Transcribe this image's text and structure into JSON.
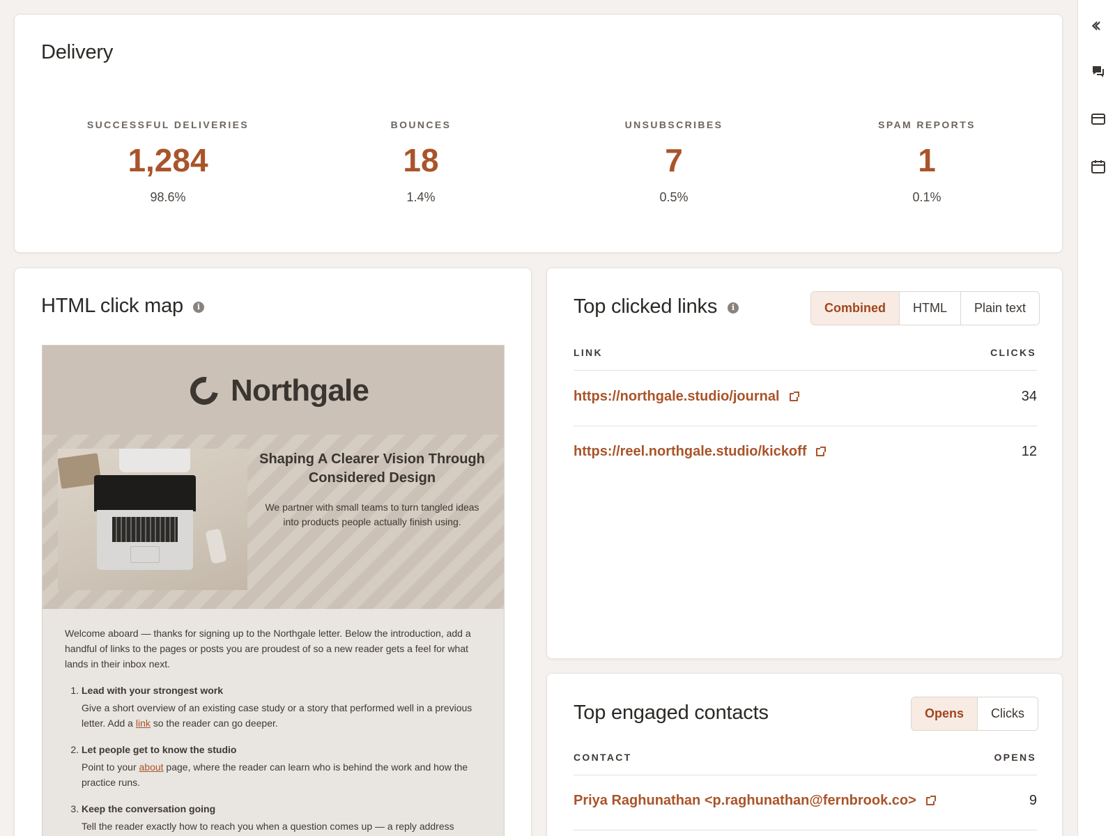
{
  "delivery": {
    "title": "Delivery",
    "stats": [
      {
        "label": "SUCCESSFUL DELIVERIES",
        "value": "1,284",
        "pct": "98.6%"
      },
      {
        "label": "BOUNCES",
        "value": "18",
        "pct": "1.4%"
      },
      {
        "label": "UNSUBSCRIBES",
        "value": "7",
        "pct": "0.5%"
      },
      {
        "label": "SPAM REPORTS",
        "value": "1",
        "pct": "0.1%"
      }
    ]
  },
  "clickmap": {
    "title": "HTML click map",
    "email": {
      "brand": "Northgale",
      "hero_title": "Shaping A Clearer Vision Through Considered Design",
      "hero_body": "We partner with small teams to turn tangled ideas into products people actually finish using.",
      "intro": "Welcome aboard — thanks for signing up to the Northgale letter. Below the introduction, add a handful of links to the pages or posts you are proudest of so a new reader gets a feel for what lands in their inbox next.",
      "items": [
        {
          "title": "Lead with your strongest work",
          "before": "Give a short overview of an existing case study or a story that performed well in a previous letter. Add a ",
          "link": "link",
          "after": " so the reader can go deeper."
        },
        {
          "title": "Let people get to know the studio",
          "before": "Point to your ",
          "link": "about",
          "after": " page, where the reader can learn who is behind the work and how the practice runs."
        },
        {
          "title": "Keep the conversation going",
          "before": "Tell the reader exactly how to reach you when a question comes up — a reply address",
          "link": "",
          "after": ""
        }
      ]
    }
  },
  "toplinks": {
    "title": "Top clicked links",
    "tabs": [
      "Combined",
      "HTML",
      "Plain text"
    ],
    "active_tab": 0,
    "col_link": "LINK",
    "col_clicks": "CLICKS",
    "rows": [
      {
        "url": "https://northgale.studio/journal",
        "clicks": "34"
      },
      {
        "url": "https://reel.northgale.studio/kickoff",
        "clicks": "12"
      }
    ]
  },
  "contacts": {
    "title": "Top engaged contacts",
    "tabs": [
      "Opens",
      "Clicks"
    ],
    "active_tab": 0,
    "col_contact": "CONTACT",
    "col_opens": "OPENS",
    "rows": [
      {
        "contact": "Priya Raghunathan <p.raghunathan@fernbrook.co>",
        "opens": "9"
      }
    ]
  },
  "rail": {
    "icons": [
      "collapse-icon",
      "chat-icon",
      "card-icon",
      "calendar-icon"
    ]
  },
  "colors": {
    "accent": "#a9542a",
    "active_tab_bg": "#f8ebe3"
  }
}
